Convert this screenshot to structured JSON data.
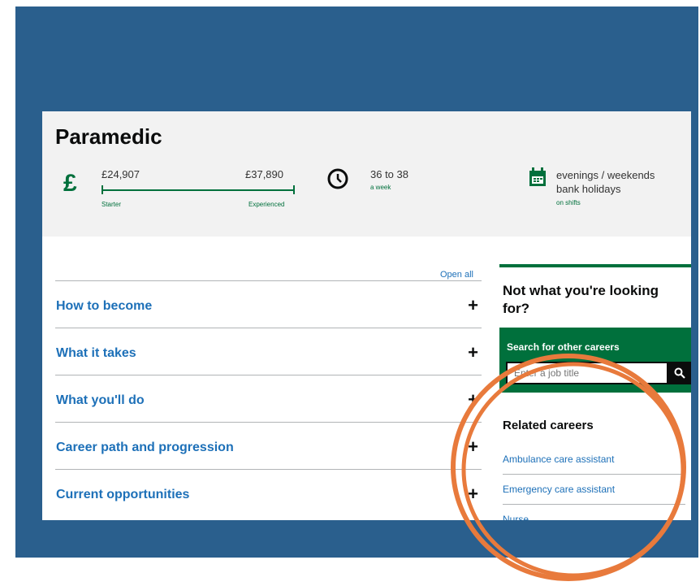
{
  "career": {
    "title": "Paramedic",
    "salary": {
      "currency_symbol": "£",
      "min": "£24,907",
      "max": "£37,890",
      "min_label": "Starter",
      "max_label": "Experienced"
    },
    "hours": {
      "value": "36 to 38",
      "unit": "a week"
    },
    "working_pattern": {
      "line1": "evenings / weekends",
      "line2": "bank holidays",
      "note": "on shifts"
    }
  },
  "accordion": {
    "open_all": "Open all",
    "items": [
      {
        "label": "How to become",
        "toggle": "+"
      },
      {
        "label": "What it takes",
        "toggle": "+"
      },
      {
        "label": "What you'll do",
        "toggle": "+"
      },
      {
        "label": "Career path and progression",
        "toggle": "+"
      },
      {
        "label": "Current opportunities",
        "toggle": "+"
      }
    ]
  },
  "sidebar": {
    "heading": "Not what you're looking for?",
    "search": {
      "label": "Search for other careers",
      "placeholder": "Enter a job title",
      "button_icon": "search-icon"
    },
    "related": {
      "heading": "Related careers",
      "links": [
        "Ambulance care assistant",
        "Emergency care assistant",
        "Nurse"
      ]
    }
  },
  "colors": {
    "frame_blue": "#2a5f8d",
    "brand_green": "#00703c",
    "link_blue": "#1d70b8",
    "highlight_orange": "#e87a3c"
  },
  "icons": [
    "pound-icon",
    "clock-icon",
    "calendar-icon",
    "plus-icon",
    "search-icon"
  ]
}
